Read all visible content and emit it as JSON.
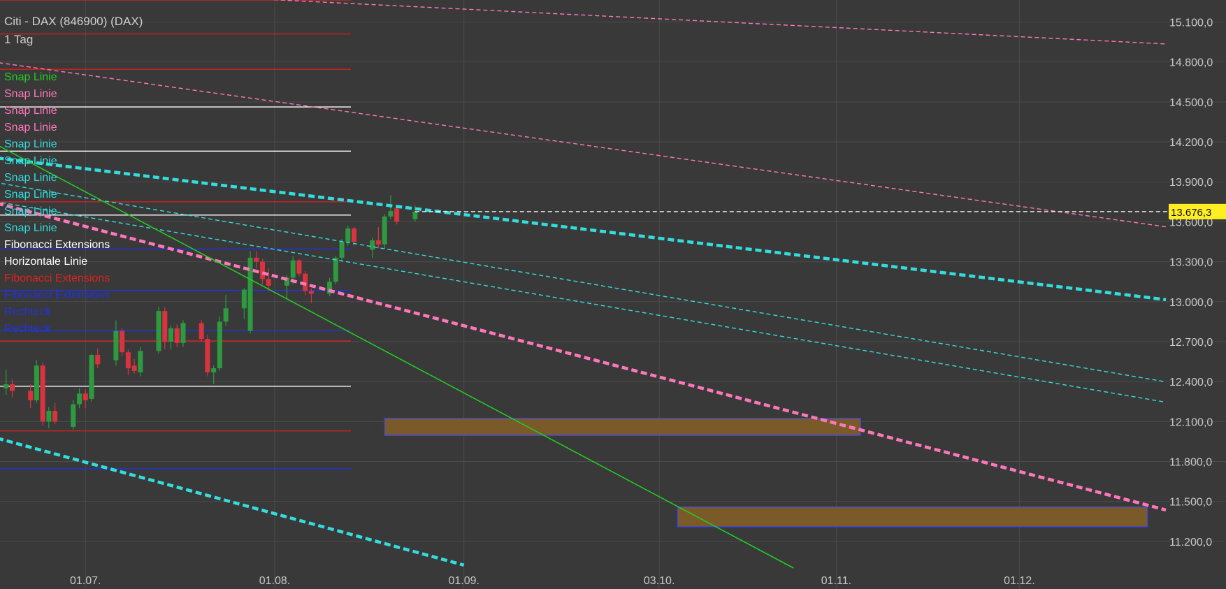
{
  "header": {
    "title": "Citi - DAX (846900) (DAX)",
    "interval": "1 Tag"
  },
  "legend": [
    {
      "label": "Snap Linie",
      "color": "#22cc22"
    },
    {
      "label": "Snap Linie",
      "color": "#ff77bb"
    },
    {
      "label": "Snap Linie",
      "color": "#ff77bb"
    },
    {
      "label": "Snap Linie",
      "color": "#ff77bb"
    },
    {
      "label": "Snap Linie",
      "color": "#33dddd"
    },
    {
      "label": "Snap Linie",
      "color": "#33dddd"
    },
    {
      "label": "Snap Linie",
      "color": "#33dddd"
    },
    {
      "label": "Snap Linie",
      "color": "#33dddd"
    },
    {
      "label": "Snap Linie",
      "color": "#33dddd"
    },
    {
      "label": "Snap Linie",
      "color": "#33dddd"
    },
    {
      "label": "Fibonacci Extensions",
      "color": "#ffffff"
    },
    {
      "label": "Horizontale Linie",
      "color": "#ffffff"
    },
    {
      "label": "Fibonacci Extensions",
      "color": "#dd2222"
    },
    {
      "label": "Fibonacci Extensions",
      "color": "#2233dd"
    },
    {
      "label": "Rechteck",
      "color": "#2233dd"
    },
    {
      "label": "Rechteck",
      "color": "#2233dd"
    }
  ],
  "current_price": {
    "label": "13.676,3",
    "value": 13676.3
  },
  "chart_data": {
    "type": "candlestick",
    "x_tick_labels": [
      "01.07.",
      "01.08.",
      "01.09.",
      "03.10.",
      "01.11.",
      "01.12."
    ],
    "x_tick_dates": [
      "2020-07-01",
      "2020-08-01",
      "2020-09-01",
      "2020-10-03",
      "2020-11-01",
      "2020-12-01"
    ],
    "y_tick_labels": [
      "15.100,0",
      "14.800,0",
      "14.500,0",
      "14.200,0",
      "13.900,0",
      "13.600,0",
      "13.300,0",
      "13.000,0",
      "12.700,0",
      "12.400,0",
      "12.100,0",
      "11.800,0",
      "11.500,0",
      "11.200,0"
    ],
    "y_ticks": [
      15100,
      14800,
      14500,
      14200,
      13900,
      13600,
      13300,
      13000,
      12700,
      12400,
      12100,
      11800,
      11500,
      11200
    ],
    "x_range": [
      "2020-06-17",
      "2020-12-25"
    ],
    "y_range": [
      11000,
      15265
    ],
    "grid": true,
    "candles": [
      {
        "date": "2020-06-18",
        "open": 12350,
        "high": 12490,
        "low": 12300,
        "close": 12380
      },
      {
        "date": "2020-06-19",
        "open": 12380,
        "high": 12420,
        "low": 12280,
        "close": 12330
      },
      {
        "date": "2020-06-22",
        "open": 12330,
        "high": 12380,
        "low": 12200,
        "close": 12260
      },
      {
        "date": "2020-06-23",
        "open": 12260,
        "high": 12560,
        "low": 12240,
        "close": 12520
      },
      {
        "date": "2020-06-24",
        "open": 12520,
        "high": 12540,
        "low": 12070,
        "close": 12100
      },
      {
        "date": "2020-06-25",
        "open": 12100,
        "high": 12210,
        "low": 12050,
        "close": 12180
      },
      {
        "date": "2020-06-26",
        "open": 12180,
        "high": 12240,
        "low": 12080,
        "close": 12100
      },
      {
        "date": "2020-06-29",
        "open": 12060,
        "high": 12260,
        "low": 12040,
        "close": 12230
      },
      {
        "date": "2020-06-30",
        "open": 12230,
        "high": 12350,
        "low": 12200,
        "close": 12310
      },
      {
        "date": "2020-07-01",
        "open": 12310,
        "high": 12340,
        "low": 12200,
        "close": 12260
      },
      {
        "date": "2020-07-02",
        "open": 12270,
        "high": 12610,
        "low": 12250,
        "close": 12600
      },
      {
        "date": "2020-07-03",
        "open": 12600,
        "high": 12650,
        "low": 12500,
        "close": 12530
      },
      {
        "date": "2020-07-06",
        "open": 12560,
        "high": 12860,
        "low": 12520,
        "close": 12780
      },
      {
        "date": "2020-07-07",
        "open": 12780,
        "high": 12800,
        "low": 12590,
        "close": 12620
      },
      {
        "date": "2020-07-08",
        "open": 12620,
        "high": 12640,
        "low": 12450,
        "close": 12500
      },
      {
        "date": "2020-07-09",
        "open": 12520,
        "high": 12570,
        "low": 12460,
        "close": 12480
      },
      {
        "date": "2020-07-10",
        "open": 12470,
        "high": 12660,
        "low": 12440,
        "close": 12630
      },
      {
        "date": "2020-07-13",
        "open": 12630,
        "high": 12960,
        "low": 12610,
        "close": 12930
      },
      {
        "date": "2020-07-14",
        "open": 12930,
        "high": 12960,
        "low": 12640,
        "close": 12700
      },
      {
        "date": "2020-07-15",
        "open": 12700,
        "high": 12820,
        "low": 12640,
        "close": 12800
      },
      {
        "date": "2020-07-16",
        "open": 12800,
        "high": 12830,
        "low": 12660,
        "close": 12690
      },
      {
        "date": "2020-07-17",
        "open": 12690,
        "high": 12860,
        "low": 12660,
        "close": 12840
      },
      {
        "date": "2020-07-20",
        "open": 12840,
        "high": 12860,
        "low": 12700,
        "close": 12720
      },
      {
        "date": "2020-07-21",
        "open": 12720,
        "high": 12750,
        "low": 12440,
        "close": 12470
      },
      {
        "date": "2020-07-22",
        "open": 12470,
        "high": 12520,
        "low": 12380,
        "close": 12500
      },
      {
        "date": "2020-07-23",
        "open": 12500,
        "high": 12890,
        "low": 12480,
        "close": 12850
      },
      {
        "date": "2020-07-24",
        "open": 12850,
        "high": 13050,
        "low": 12820,
        "close": 12950
      },
      {
        "date": "2020-07-27",
        "open": 12950,
        "high": 13100,
        "low": 12870,
        "close": 13090
      },
      {
        "date": "2020-07-28",
        "open": 12780,
        "high": 13380,
        "low": 12760,
        "close": 13330
      },
      {
        "date": "2020-07-29",
        "open": 13330,
        "high": 13380,
        "low": 13250,
        "close": 13300
      },
      {
        "date": "2020-07-30",
        "open": 13300,
        "high": 13320,
        "low": 13130,
        "close": 13170
      },
      {
        "date": "2020-07-31",
        "open": 13170,
        "high": 13250,
        "low": 13080,
        "close": 13120
      },
      {
        "date": "2020-08-03",
        "open": 13120,
        "high": 13200,
        "low": 13020,
        "close": 13180
      },
      {
        "date": "2020-08-04",
        "open": 13180,
        "high": 13340,
        "low": 13130,
        "close": 13310
      },
      {
        "date": "2020-08-05",
        "open": 13310,
        "high": 13320,
        "low": 13190,
        "close": 13210
      },
      {
        "date": "2020-08-06",
        "open": 13210,
        "high": 13230,
        "low": 13050,
        "close": 13080
      },
      {
        "date": "2020-08-07",
        "open": 13080,
        "high": 13100,
        "low": 12990,
        "close": 13060
      },
      {
        "date": "2020-08-10",
        "open": 13060,
        "high": 13180,
        "low": 13040,
        "close": 13150
      },
      {
        "date": "2020-08-11",
        "open": 13150,
        "high": 13340,
        "low": 13130,
        "close": 13330
      },
      {
        "date": "2020-08-12",
        "open": 13330,
        "high": 13470,
        "low": 13300,
        "close": 13450
      },
      {
        "date": "2020-08-13",
        "open": 13450,
        "high": 13570,
        "low": 13420,
        "close": 13550
      },
      {
        "date": "2020-08-14",
        "open": 13550,
        "high": 13560,
        "low": 13420,
        "close": 13450
      },
      {
        "date": "2020-08-17",
        "open": 13390,
        "high": 13480,
        "low": 13330,
        "close": 13460
      },
      {
        "date": "2020-08-18",
        "open": 13460,
        "high": 13560,
        "low": 13400,
        "close": 13430
      },
      {
        "date": "2020-08-19",
        "open": 13430,
        "high": 13660,
        "low": 13400,
        "close": 13640
      },
      {
        "date": "2020-08-20",
        "open": 13640,
        "high": 13800,
        "low": 13620,
        "close": 13680
      },
      {
        "date": "2020-08-21",
        "open": 13700,
        "high": 13720,
        "low": 13580,
        "close": 13600
      },
      {
        "date": "2020-08-24",
        "open": 13620,
        "high": 13720,
        "low": 13600,
        "close": 13676
      }
    ],
    "horizontal_lines": [
      {
        "y": 15265,
        "color": "#cc2222"
      },
      {
        "y": 15010,
        "color": "#cc2222"
      },
      {
        "y": 14745,
        "color": "#cc2222"
      },
      {
        "y": 14462,
        "color": "#ffffff"
      },
      {
        "y": 14130,
        "color": "#ffffff"
      },
      {
        "y": 13750,
        "color": "#cc2222"
      },
      {
        "y": 13650,
        "color": "#ffffff"
      },
      {
        "y": 13395,
        "color": "#2233dd"
      },
      {
        "y": 13085,
        "color": "#2233dd"
      },
      {
        "y": 12785,
        "color": "#2233dd"
      },
      {
        "y": 12705,
        "color": "#cc2222"
      },
      {
        "y": 12365,
        "color": "#ffffff"
      },
      {
        "y": 12030,
        "color": "#cc2222"
      },
      {
        "y": 11745,
        "color": "#2233dd"
      }
    ],
    "trend_lines": [
      {
        "from": [
          "2020-06-10",
          14838
        ],
        "to": [
          "2020-12-25",
          13562
        ],
        "color": "#ff77bb",
        "style": "thin-dashed"
      },
      {
        "from": [
          "2020-07-25",
          15283
        ],
        "to": [
          "2020-12-25",
          14935
        ],
        "color": "#ff77bb",
        "style": "thin-dashed"
      },
      {
        "from": [
          "2020-06-15",
          14087
        ],
        "to": [
          "2020-12-25",
          13015
        ],
        "color": "#33dddd",
        "style": "thick-dashed"
      },
      {
        "from": [
          "2020-06-15",
          11994
        ],
        "to": [
          "2020-09-01",
          11022
        ],
        "color": "#33dddd",
        "style": "thick-dashed"
      },
      {
        "from": [
          "2020-06-15",
          13905
        ],
        "to": [
          "2020-12-25",
          12398
        ],
        "color": "#33dddd",
        "style": "thin-dashed"
      },
      {
        "from": [
          "2020-06-15",
          13762
        ],
        "to": [
          "2020-12-25",
          12245
        ],
        "color": "#33dddd",
        "style": "thin-dashed"
      },
      {
        "from": [
          "2020-06-15",
          13757
        ],
        "to": [
          "2020-12-25",
          11436
        ],
        "color": "#ff77bb",
        "style": "thick-dashed"
      },
      {
        "from": [
          "2020-06-15",
          14214
        ],
        "to": [
          "2020-10-25",
          11000
        ],
        "color": "#22cc22",
        "style": "solid"
      }
    ],
    "rectangles": [
      {
        "x0": "2020-08-19",
        "x1": "2020-11-05",
        "y0": 11995,
        "y1": 12125,
        "fill": "#7a5a28",
        "stroke": "#3344ff"
      },
      {
        "x0": "2020-10-06",
        "x1": "2020-12-22",
        "y0": 11310,
        "y1": 11460,
        "fill": "#7a5a28",
        "stroke": "#3344ff"
      }
    ]
  }
}
